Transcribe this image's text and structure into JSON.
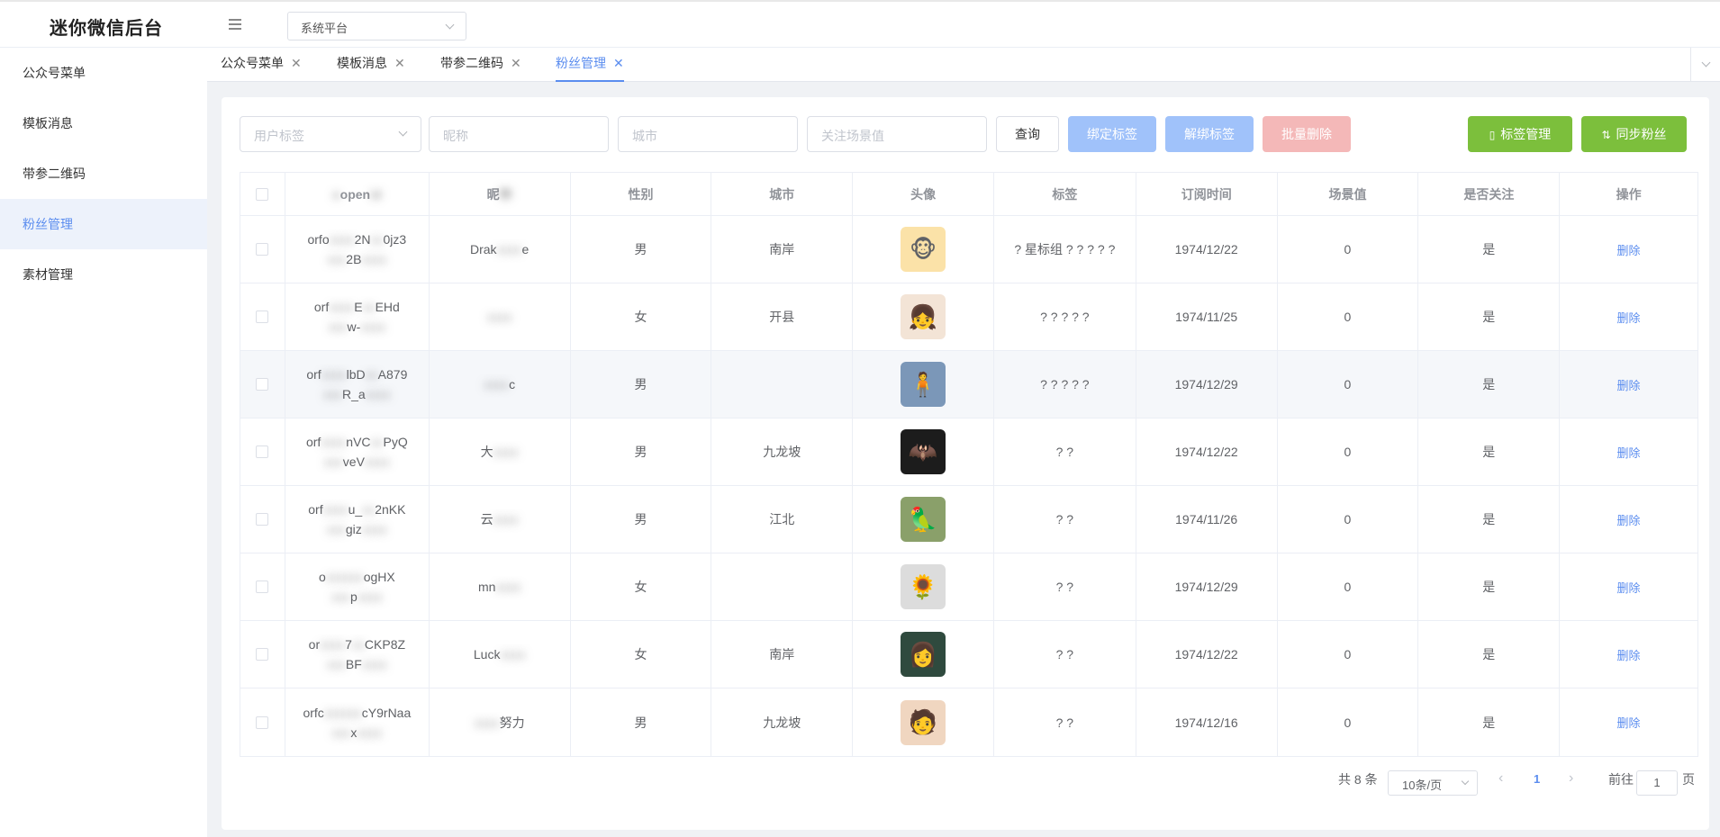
{
  "header": {
    "logo": "迷你微信后台",
    "platform_select": "系统平台"
  },
  "sidebar": {
    "items": [
      {
        "label": "公众号菜单",
        "active": false
      },
      {
        "label": "模板消息",
        "active": false
      },
      {
        "label": "带参二维码",
        "active": false
      },
      {
        "label": "粉丝管理",
        "active": true
      },
      {
        "label": "素材管理",
        "active": false
      }
    ]
  },
  "tabs": [
    {
      "label": "公众号菜单",
      "active": false
    },
    {
      "label": "模板消息",
      "active": false
    },
    {
      "label": "带参二维码",
      "active": false
    },
    {
      "label": "粉丝管理",
      "active": true
    }
  ],
  "filters": {
    "tag_placeholder": "用户标签",
    "nickname_placeholder": "昵称",
    "city_placeholder": "城市",
    "scene_placeholder": "关注场景值"
  },
  "buttons": {
    "query": "查询",
    "bind_tag": "绑定标签",
    "unbind_tag": "解绑标签",
    "batch_delete": "批量删除",
    "tag_manage": "标签管理",
    "sync_fans": "同步粉丝"
  },
  "table": {
    "columns": [
      "openid",
      "昵称",
      "性别",
      "城市",
      "头像",
      "标签",
      "订阅时间",
      "场景值",
      "是否关注",
      "操作"
    ],
    "header_openid": "open",
    "header_nickname": "昵",
    "rows": [
      {
        "openid_a": "orfo",
        "openid_b": "2N",
        "openid_c": "0jz3",
        "openid_d": "2B",
        "nick_a": "Drak",
        "nick_b": "e",
        "gender": "男",
        "city": "南岸",
        "avatar_icon": "monkey-icon",
        "avatar_glyph": "🐵",
        "avatar_bg": "#fbe2a8",
        "tag": "? 星标组 ? ? ? ? ?",
        "date": "1974/12/22",
        "scene": "0",
        "subscribed": "是",
        "action": "删除"
      },
      {
        "openid_a": "orf",
        "openid_b": "E",
        "openid_c": "EHd",
        "openid_d": "w-",
        "nick_a": "",
        "nick_b": "",
        "gender": "女",
        "city": "开县",
        "avatar_icon": "girl-icon",
        "avatar_glyph": "👧",
        "avatar_bg": "#f3e4d6",
        "tag": "? ? ? ? ?",
        "date": "1974/11/25",
        "scene": "0",
        "subscribed": "是",
        "action": "删除"
      },
      {
        "openid_a": "orf",
        "openid_b": "lbD",
        "openid_c": "A879",
        "openid_d": "R_a",
        "nick_a": "",
        "nick_b": "c",
        "gender": "男",
        "city": "",
        "avatar_icon": "figure-icon",
        "avatar_glyph": "🧍",
        "avatar_bg": "#7b97b8",
        "tag": "? ? ? ? ?",
        "date": "1974/12/29",
        "scene": "0",
        "subscribed": "是",
        "action": "删除"
      },
      {
        "openid_a": "orf",
        "openid_b": "nVC",
        "openid_c": "PyQ",
        "openid_d": "veV",
        "nick_a": "大",
        "nick_b": "",
        "gender": "男",
        "city": "九龙坡",
        "avatar_icon": "bat-icon",
        "avatar_glyph": "🦇",
        "avatar_bg": "#1c1c1c",
        "tag": "? ?",
        "date": "1974/12/22",
        "scene": "0",
        "subscribed": "是",
        "action": "删除"
      },
      {
        "openid_a": "orf",
        "openid_b": "u_",
        "openid_c": "2nKK",
        "openid_d": "giz",
        "nick_a": "云",
        "nick_b": "",
        "gender": "男",
        "city": "江北",
        "avatar_icon": "parrot-icon",
        "avatar_glyph": "🦜",
        "avatar_bg": "#8aa06a",
        "tag": "? ?",
        "date": "1974/11/26",
        "scene": "0",
        "subscribed": "是",
        "action": "删除"
      },
      {
        "openid_a": "o",
        "openid_b": "",
        "openid_c": "ogHX",
        "openid_d": "p",
        "nick_a": "mn",
        "nick_b": "",
        "gender": "女",
        "city": "",
        "avatar_icon": "flower-icon",
        "avatar_glyph": "🌻",
        "avatar_bg": "#dcdcdc",
        "tag": "? ?",
        "date": "1974/12/29",
        "scene": "0",
        "subscribed": "是",
        "action": "删除"
      },
      {
        "openid_a": "or",
        "openid_b": "7",
        "openid_c": "CKP8Z",
        "openid_d": "BF",
        "nick_a": "Luck",
        "nick_b": "",
        "gender": "女",
        "city": "南岸",
        "avatar_icon": "woman-icon",
        "avatar_glyph": "👩",
        "avatar_bg": "#2f4a3e",
        "tag": "? ?",
        "date": "1974/12/22",
        "scene": "0",
        "subscribed": "是",
        "action": "删除"
      },
      {
        "openid_a": "orfc",
        "openid_b": "",
        "openid_c": "cY9rNaa",
        "openid_d": "x",
        "nick_a": "",
        "nick_b": "努力",
        "gender": "男",
        "city": "九龙坡",
        "avatar_icon": "umbrella-man-icon",
        "avatar_glyph": "🧑",
        "avatar_bg": "#f0d6c0",
        "tag": "? ?",
        "date": "1974/12/16",
        "scene": "0",
        "subscribed": "是",
        "action": "删除"
      }
    ]
  },
  "pagination": {
    "total": "共 8 条",
    "page_size": "10条/页",
    "current": "1",
    "goto_prefix": "前往",
    "goto_value": "1",
    "goto_suffix": "页"
  },
  "colors": {
    "accent": "#5b8def",
    "green": "#7cbf3c",
    "disabled_blue": "#a0c2fa",
    "disabled_red": "#f4b8b8"
  }
}
